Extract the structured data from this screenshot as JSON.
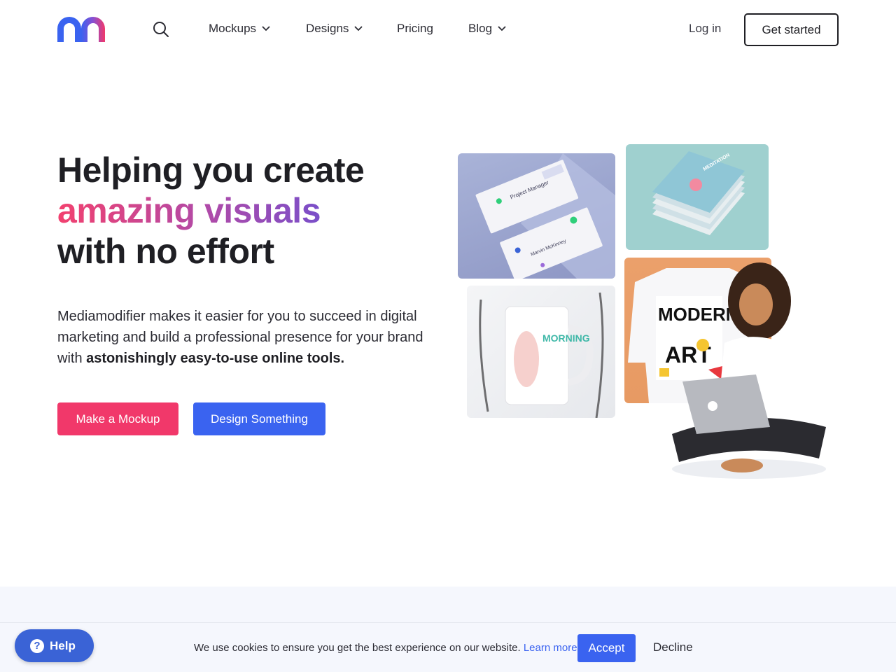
{
  "nav": {
    "logo_alt": "Mediamodifier",
    "items": [
      {
        "label": "Mockups",
        "has_dropdown": true
      },
      {
        "label": "Designs",
        "has_dropdown": true
      },
      {
        "label": "Pricing",
        "has_dropdown": false
      },
      {
        "label": "Blog",
        "has_dropdown": true
      }
    ],
    "login_label": "Log in",
    "get_started_label": "Get started"
  },
  "hero": {
    "title_line1": "Helping you create",
    "title_highlight": "amazing visuals",
    "title_line3": "with no effort",
    "text_plain": "Mediamodifier makes it easier for you to succeed in digital marketing and build a professional presence for your brand with ",
    "text_bold": "astonishingly easy-to-use online tools.",
    "primary_button": "Make a Mockup",
    "secondary_button": "Design Something"
  },
  "collage": {
    "card_name1": "Project Manager",
    "card_name2": "Marvin McKinney",
    "book_title": "MEDITATION",
    "mug_text": "MORNING",
    "shirt_text_1": "MODERN",
    "shirt_text_2": "ART"
  },
  "cookie": {
    "message": "We use cookies to ensure you get the best experience on our website.",
    "learn_more": "Learn more",
    "accept_label": "Accept",
    "decline_label": "Decline"
  },
  "help": {
    "label": "Help"
  },
  "colors": {
    "primary_pink": "#f1386a",
    "primary_blue": "#3a63f0",
    "text_dark": "#1f1f24"
  }
}
